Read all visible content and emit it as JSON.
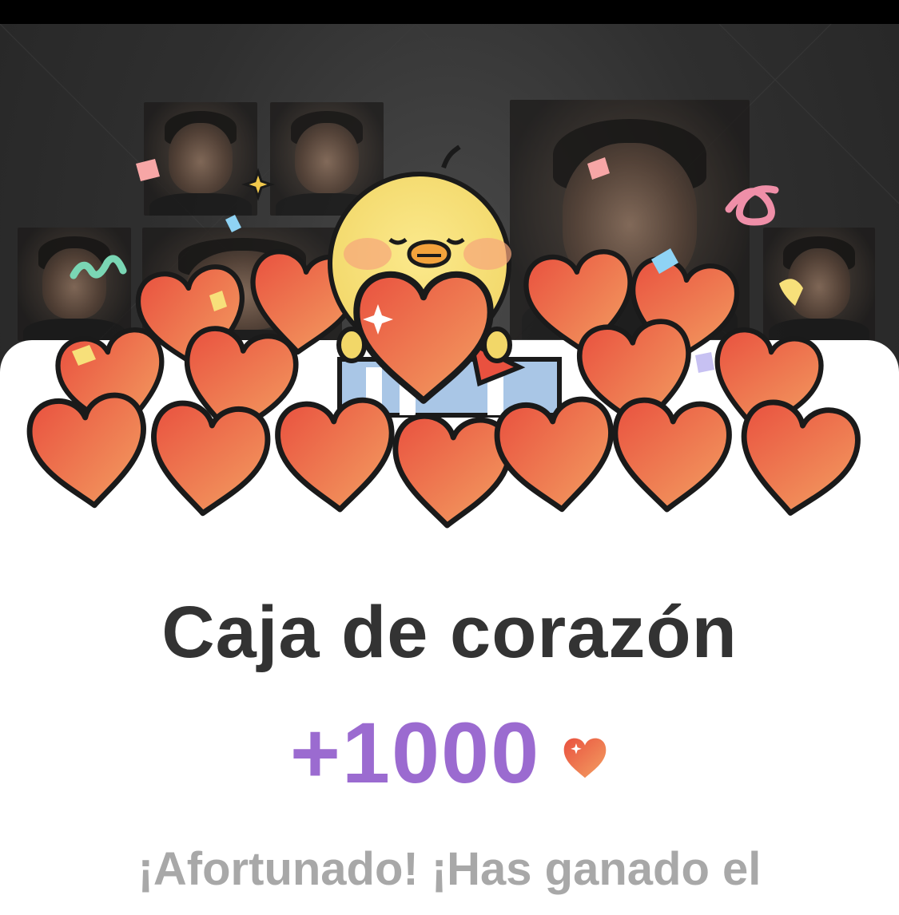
{
  "reward": {
    "title": "Caja de corazón",
    "amount": "+1000",
    "message": "¡Afortunado! ¡Has ganado el"
  },
  "icons": {
    "currency_icon": "heart-icon",
    "mascot": "yellow-chick-holding-heart",
    "decoration": "confetti"
  },
  "colors": {
    "title": "#333333",
    "amount": "#9b6bd0",
    "message": "#a8a8a8",
    "heart_light": "#f3a062",
    "heart_dark": "#e9513f",
    "chick": "#f7e07a"
  }
}
